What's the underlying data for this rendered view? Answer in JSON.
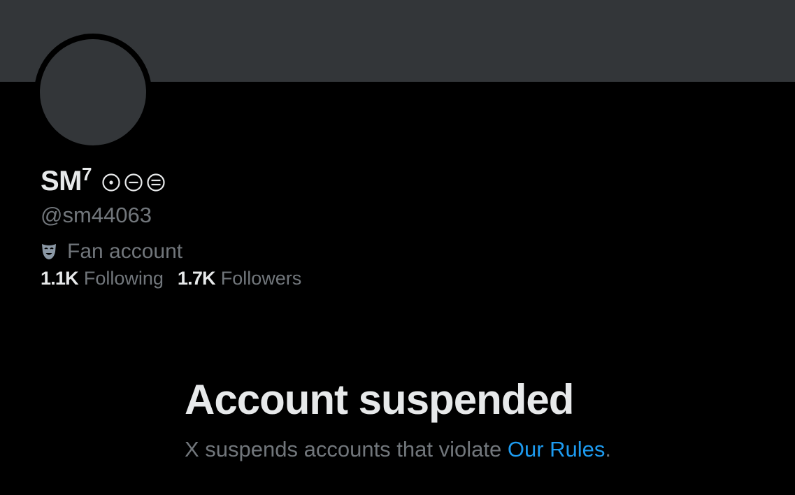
{
  "profile": {
    "display_name": "SM",
    "display_name_superscript": "7",
    "handle": "@sm44063",
    "bio": {
      "icon": "theater-mask-icon",
      "text": "Fan account"
    },
    "name_symbols": [
      "dotted-circle-icon",
      "minus-circle-icon",
      "equals-circle-icon"
    ],
    "stats": {
      "following_count": "1.1K",
      "following_label": "Following",
      "followers_count": "1.7K",
      "followers_label": "Followers"
    }
  },
  "suspension": {
    "title": "Account suspended",
    "description_prefix": "X suspends accounts that violate ",
    "link_text": "Our Rules",
    "description_suffix": "."
  },
  "colors": {
    "background": "#000000",
    "banner": "#333639",
    "avatar": "#333639",
    "primary_text": "#e7e9ea",
    "secondary_text": "#71767b",
    "link": "#1d9bf0"
  }
}
